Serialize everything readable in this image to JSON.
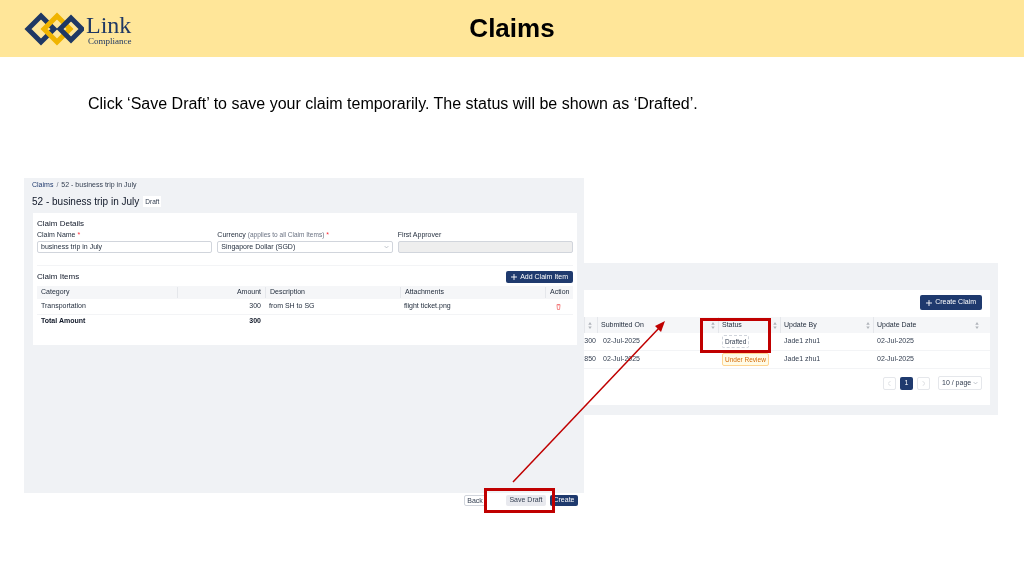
{
  "header": {
    "logo_name": "Link",
    "logo_sub": "Compliance",
    "title": "Claims"
  },
  "instruction": "Click ‘Save Draft’ to save your claim temporarily. The status will be shown as ‘Drafted’.",
  "claim_form": {
    "breadcrumb": [
      "Claims",
      "52 - business trip in July"
    ],
    "separator": "/",
    "title": "52 - business trip in July",
    "badge": "Draft",
    "section": "Claim Details",
    "fields": [
      {
        "label": "Claim Name",
        "required_mark": "*",
        "kind": "text",
        "value": "business trip in July"
      },
      {
        "label": "Currency",
        "hint": "(applies to all Claim Items)",
        "required_mark": "*",
        "kind": "select",
        "value": "Singapore Dollar (SGD)"
      },
      {
        "label": "First Approver",
        "kind": "disabled"
      }
    ],
    "items_title": "Claim Items",
    "add_button": "Add Claim Item",
    "columns": [
      "Category",
      "Amount",
      "Description",
      "Attachments",
      "Action"
    ],
    "rows": [
      {
        "category": "Transportation",
        "amount": "300",
        "description": "from SH to SG",
        "attachment": "flight ticket.png"
      }
    ],
    "total": {
      "label": "Total Amount",
      "amount": "300"
    },
    "buttons": [
      {
        "label": "Back",
        "kind": "default"
      },
      {
        "label": "Save Draft",
        "kind": "secondary"
      },
      {
        "label": "Create",
        "kind": "primary"
      }
    ]
  },
  "claims_list": {
    "create_button": "Create Claim",
    "columns": [
      "",
      "Submitted On",
      "Status",
      "Update By",
      "Update Date"
    ],
    "rows": [
      {
        "amount": "300",
        "submitted": "02-Jul-2025",
        "status": "Drafted",
        "kind": "draft",
        "update_by": "Jade1 zhu1",
        "update_date": "02-Jul-2025"
      },
      {
        "amount": "850",
        "submitted": "02-Jul-2025",
        "status": "Under Review",
        "kind": "review",
        "update_by": "Jade1 zhu1",
        "update_date": "02-Jul-2025"
      }
    ],
    "pages": [
      {
        "label": "1",
        "selected": true
      }
    ],
    "page_size": "10 / page"
  }
}
